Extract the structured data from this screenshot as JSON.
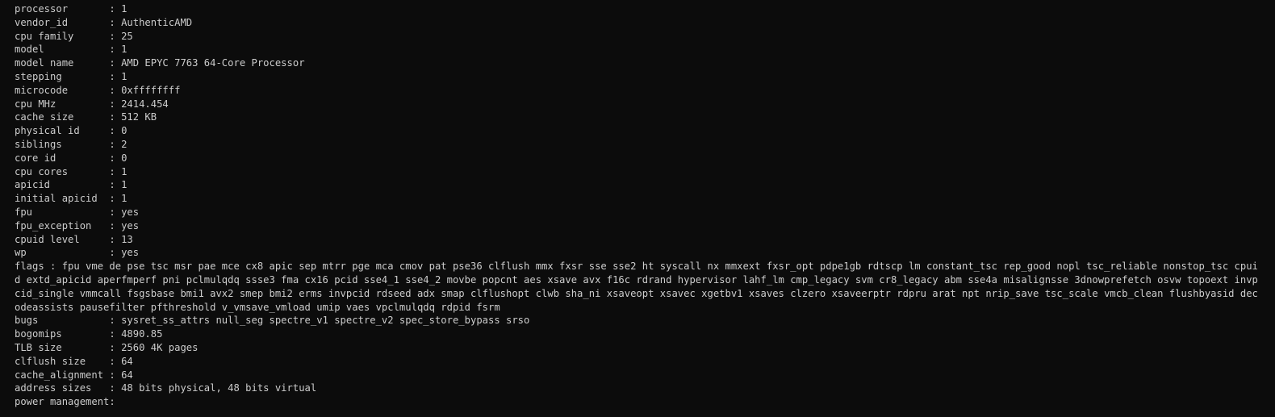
{
  "terminal": {
    "lines": [
      "processor       : 1",
      "vendor_id       : AuthenticAMD",
      "cpu family      : 25",
      "model           : 1",
      "model name      : AMD EPYC 7763 64-Core Processor",
      "stepping        : 1",
      "microcode       : 0xffffffff",
      "cpu MHz         : 2414.454",
      "cache size      : 512 KB",
      "physical id     : 0",
      "siblings        : 2",
      "core id         : 0",
      "cpu cores       : 1",
      "apicid          : 1",
      "initial apicid  : 1",
      "fpu             : yes",
      "fpu_exception   : yes",
      "cpuid level     : 13",
      "wp              : yes"
    ],
    "flags_line": "flags           : fpu vme de pse tsc msr pae mce cx8 apic sep mtrr pge mca cmov pat pse36 clflush mmx fxsr sse sse2 ht syscall nx mmxext fxsr_opt pdpe1gb rdtscp lm constant_tsc rep_good nopl tsc_reliable nonstop_tsc cpuid extd_apicid aperfmperf pni pclmulqdq ssse3 fma cx16 pcid sse4_1 sse4_2 movbe popcnt aes xsave avx f16c rdrand hypervisor lahf_lm cmp_legacy svm cr8_legacy abm sse4a misalignsse 3dnowprefetch osvw topoext invpcid_single vmmcall fsgsbase bmi1 avx2 smep bmi2 erms invpcid rdseed adx smap clflushopt clwb sha_ni xsaveopt xsavec xgetbv1 xsaves clzero xsaveerptr rdpru arat npt nrip_save tsc_scale vmcb_clean flushbyasid decodeassists pausefilter pfthreshold v_vmsave_vmload umip vaes vpclmulqdq rdpid fsrm",
    "lines_after": [
      "bugs            : sysret_ss_attrs null_seg spectre_v1 spectre_v2 spec_store_bypass srso",
      "bogomips        : 4890.85",
      "TLB size        : 2560 4K pages",
      "clflush size    : 64",
      "cache_alignment : 64",
      "address sizes   : 48 bits physical, 48 bits virtual",
      "power management:"
    ],
    "colors": {
      "background": "#0c0c0c",
      "text": "#cccccc"
    }
  }
}
